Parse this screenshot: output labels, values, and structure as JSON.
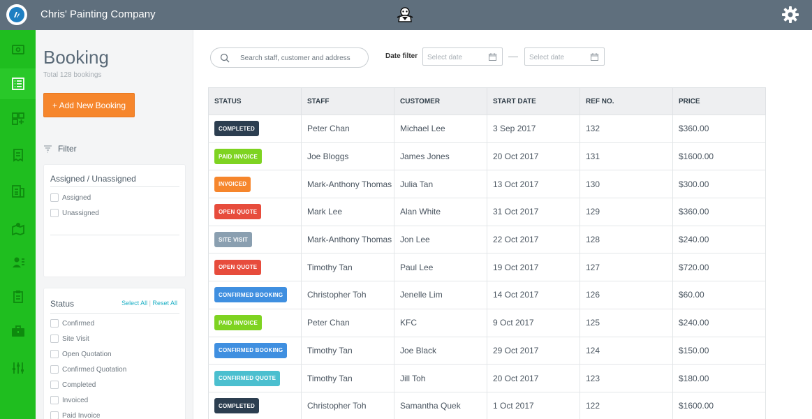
{
  "app": {
    "title": "Chris' Painting Company",
    "logo_icon": "brush-logo-icon",
    "mascot_icon": "mascot-icon",
    "settings_icon": "gear-icon"
  },
  "rail": {
    "items": [
      {
        "icon": "wallet-icon"
      },
      {
        "icon": "list-icon",
        "active": true
      },
      {
        "icon": "grid-icon"
      },
      {
        "icon": "receipt-icon"
      },
      {
        "icon": "document-icon"
      },
      {
        "icon": "map-pin-icon"
      },
      {
        "icon": "contacts-icon"
      },
      {
        "icon": "clipboard-icon"
      },
      {
        "icon": "briefcase-icon"
      },
      {
        "icon": "sliders-icon"
      }
    ]
  },
  "page": {
    "title": "Booking",
    "total": "Total 128 bookings",
    "add_button": "+ Add New Booking",
    "filter_label": "Filter"
  },
  "assigned_card": {
    "title": "Assigned / Unassigned",
    "options": [
      "Assigned",
      "Unassigned"
    ]
  },
  "status_card": {
    "title": "Status",
    "select_all": "Select All",
    "reset_all": "Reset All",
    "options": [
      "Confirmed",
      "Site Visit",
      "Open Quotation",
      "Confirmed Quotation",
      "Completed",
      "Invoiced",
      "Paid Invoice"
    ]
  },
  "search": {
    "placeholder": "Search staff, customer and address"
  },
  "date_filter": {
    "label": "Date filter",
    "start_placeholder": "Select date",
    "end_placeholder": "Select date"
  },
  "colors": {
    "green_rail": "#1fbe1f",
    "topbar": "#5f6f7d",
    "orange": "#f6862c",
    "completed": "#2c3e50",
    "paid_invoice": "#7ed321",
    "invoiced": "#f6862c",
    "open_quote": "#e74c3c",
    "site_visit": "#8a9fb0",
    "confirmed_booking": "#3f8fe0",
    "confirmed_quote": "#4bbfcf"
  },
  "table": {
    "columns": [
      "STATUS",
      "STAFF",
      "CUSTOMER",
      "START DATE",
      "REF NO.",
      "PRICE"
    ],
    "rows": [
      {
        "status": "COMPLETED",
        "status_color": "#2c3e50",
        "staff": "Peter Chan",
        "customer": "Michael Lee",
        "start": "3 Sep 2017",
        "ref": "132",
        "price": "$360.00"
      },
      {
        "status": "PAID INVOICE",
        "status_color": "#7ed321",
        "staff": "Joe Bloggs",
        "customer": "James Jones",
        "start": "20 Oct 2017",
        "ref": "131",
        "price": "$1600.00"
      },
      {
        "status": "INVOICED",
        "status_color": "#f6862c",
        "staff": "Mark-Anthony Thomas",
        "customer": "Julia Tan",
        "start": "13 Oct 2017",
        "ref": "130",
        "price": "$300.00"
      },
      {
        "status": "OPEN QUOTE",
        "status_color": "#e74c3c",
        "staff": "Mark Lee",
        "customer": "Alan White",
        "start": "31 Oct 2017",
        "ref": "129",
        "price": "$360.00"
      },
      {
        "status": "SITE VISIT",
        "status_color": "#8a9fb0",
        "staff": "Mark-Anthony Thomas",
        "customer": "Jon Lee",
        "start": "22 Oct 2017",
        "ref": "128",
        "price": "$240.00"
      },
      {
        "status": "OPEN QUOTE",
        "status_color": "#e74c3c",
        "staff": "Timothy Tan",
        "customer": "Paul Lee",
        "start": "19 Oct 2017",
        "ref": "127",
        "price": "$720.00"
      },
      {
        "status": "CONFIRMED BOOKING",
        "status_color": "#3f8fe0",
        "staff": "Christopher Toh",
        "customer": "Jenelle Lim",
        "start": "14 Oct 2017",
        "ref": "126",
        "price": "$60.00"
      },
      {
        "status": "PAID INVOICE",
        "status_color": "#7ed321",
        "staff": "Peter Chan",
        "customer": "KFC",
        "start": "9 Oct 2017",
        "ref": "125",
        "price": "$240.00"
      },
      {
        "status": "CONFIRMED BOOKING",
        "status_color": "#3f8fe0",
        "staff": "Timothy Tan",
        "customer": "Joe Black",
        "start": "29 Oct 2017",
        "ref": "124",
        "price": "$150.00"
      },
      {
        "status": "CONFIRMED QUOTE",
        "status_color": "#4bbfcf",
        "staff": "Timothy Tan",
        "customer": "Jill Toh",
        "start": "20 Oct 2017",
        "ref": "123",
        "price": "$180.00"
      },
      {
        "status": "COMPLETED",
        "status_color": "#2c3e50",
        "staff": "Christopher Toh",
        "customer": "Samantha Quek",
        "start": "1 Oct 2017",
        "ref": "122",
        "price": "$1600.00"
      }
    ]
  }
}
